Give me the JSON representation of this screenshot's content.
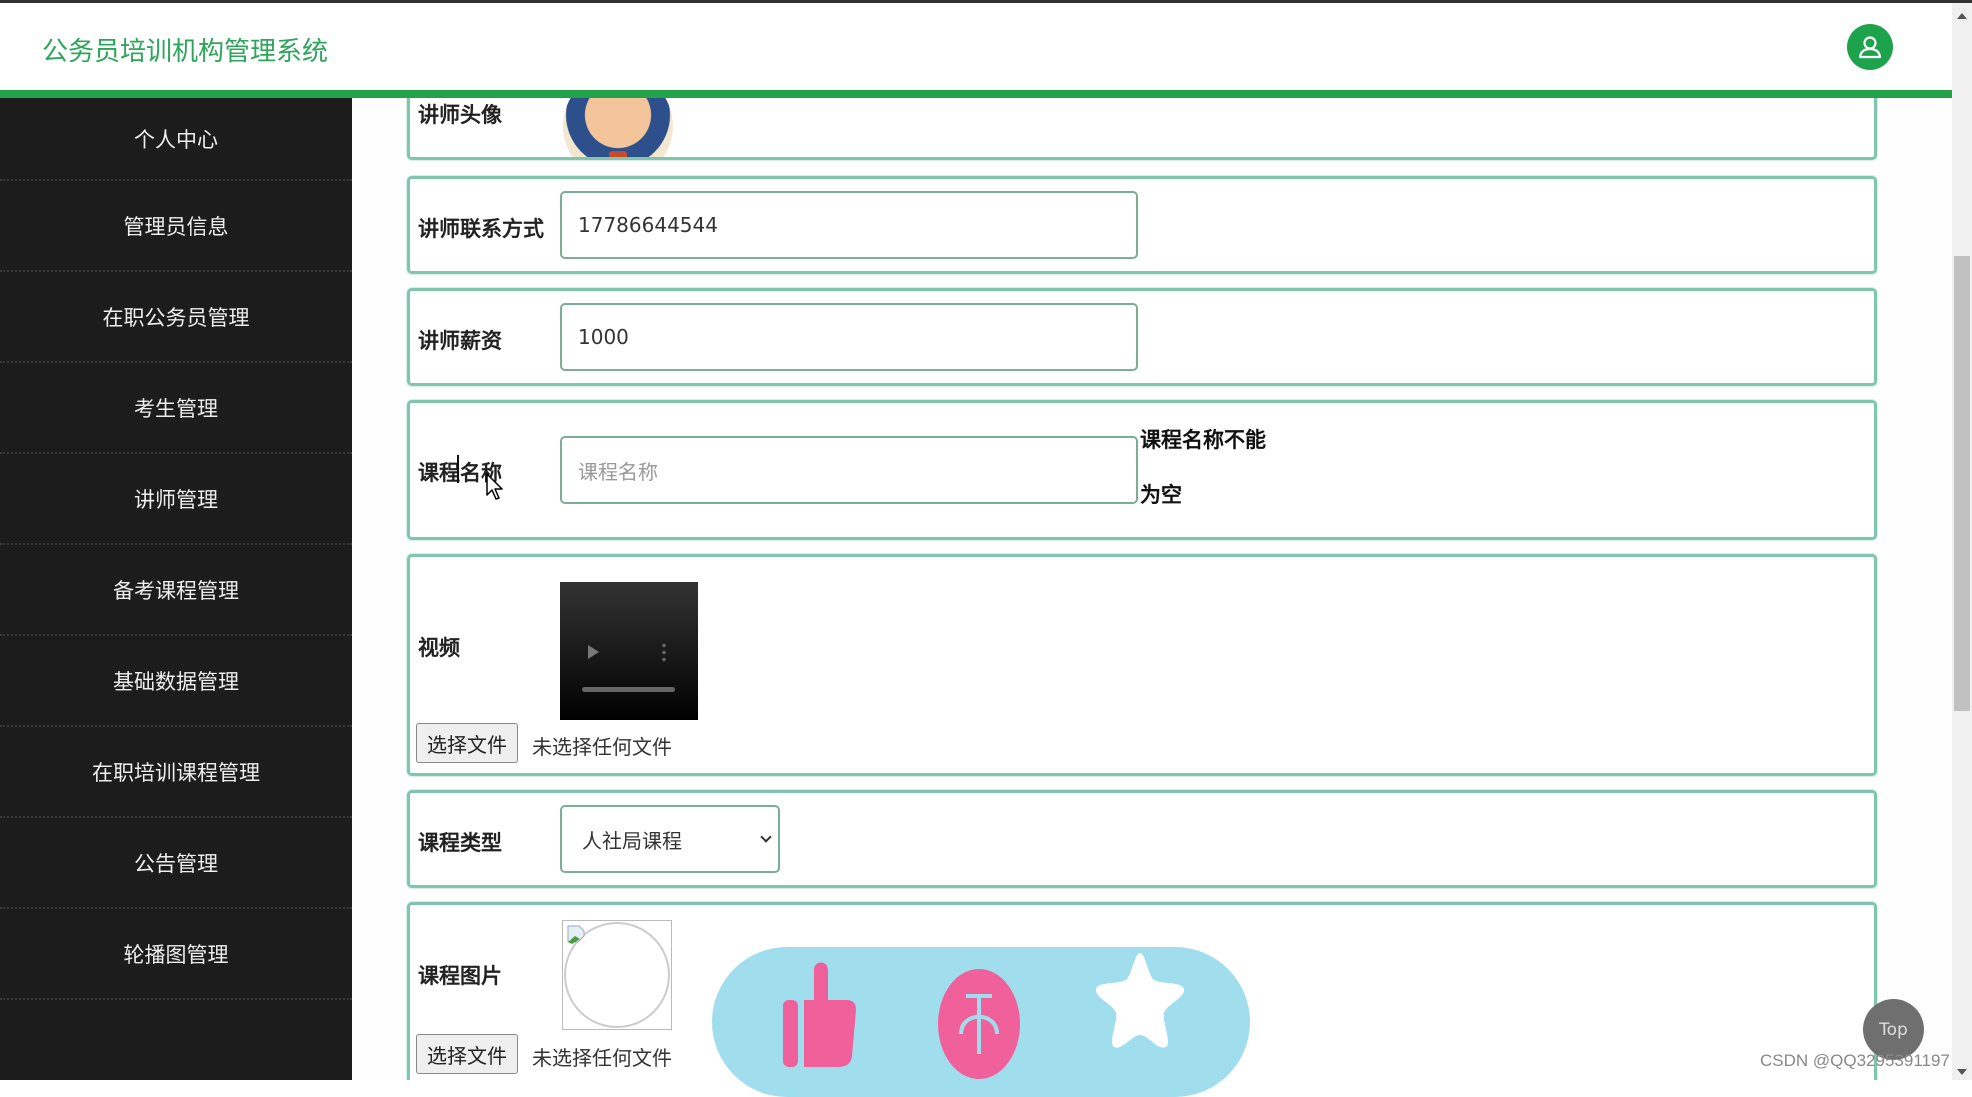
{
  "header": {
    "title": "公务员培训机构管理系统",
    "user_icon": "user-icon"
  },
  "colors": {
    "brand_green": "#22a34a",
    "sidebar_bg": "#1c1c1c",
    "form_border": "#7fc6ad",
    "share_bar_bg": "#a0dded",
    "share_icon_pink": "#f06292"
  },
  "sidebar": {
    "items": [
      {
        "label": "个人中心"
      },
      {
        "label": "管理员信息"
      },
      {
        "label": "在职公务员管理"
      },
      {
        "label": "考生管理"
      },
      {
        "label": "讲师管理"
      },
      {
        "label": "备考课程管理"
      },
      {
        "label": "基础数据管理"
      },
      {
        "label": "在职培训课程管理"
      },
      {
        "label": "公告管理"
      },
      {
        "label": "轮播图管理"
      }
    ]
  },
  "form": {
    "avatar_label": "讲师头像",
    "contact": {
      "label": "讲师联系方式",
      "value": "17786644544"
    },
    "salary": {
      "label": "讲师薪资",
      "value": "1000"
    },
    "course_name": {
      "label": "课程名称",
      "placeholder": "课程名称",
      "value": "",
      "error": "课程名称不能为空",
      "error_line1": "课程名称不能",
      "error_line2": "为空"
    },
    "video": {
      "label": "视频",
      "file_button": "选择文件",
      "file_status": "未选择任何文件"
    },
    "course_type": {
      "label": "课程类型",
      "selected": "人社局课程"
    },
    "course_image": {
      "label": "课程图片",
      "file_button": "选择文件",
      "file_status": "未选择任何文件"
    }
  },
  "share_bar": {
    "icons": [
      "thumbs-up-icon",
      "coin-icon",
      "star-icon"
    ]
  },
  "top_button": {
    "label": "Top"
  },
  "watermark": "CSDN @QQ3295391197"
}
